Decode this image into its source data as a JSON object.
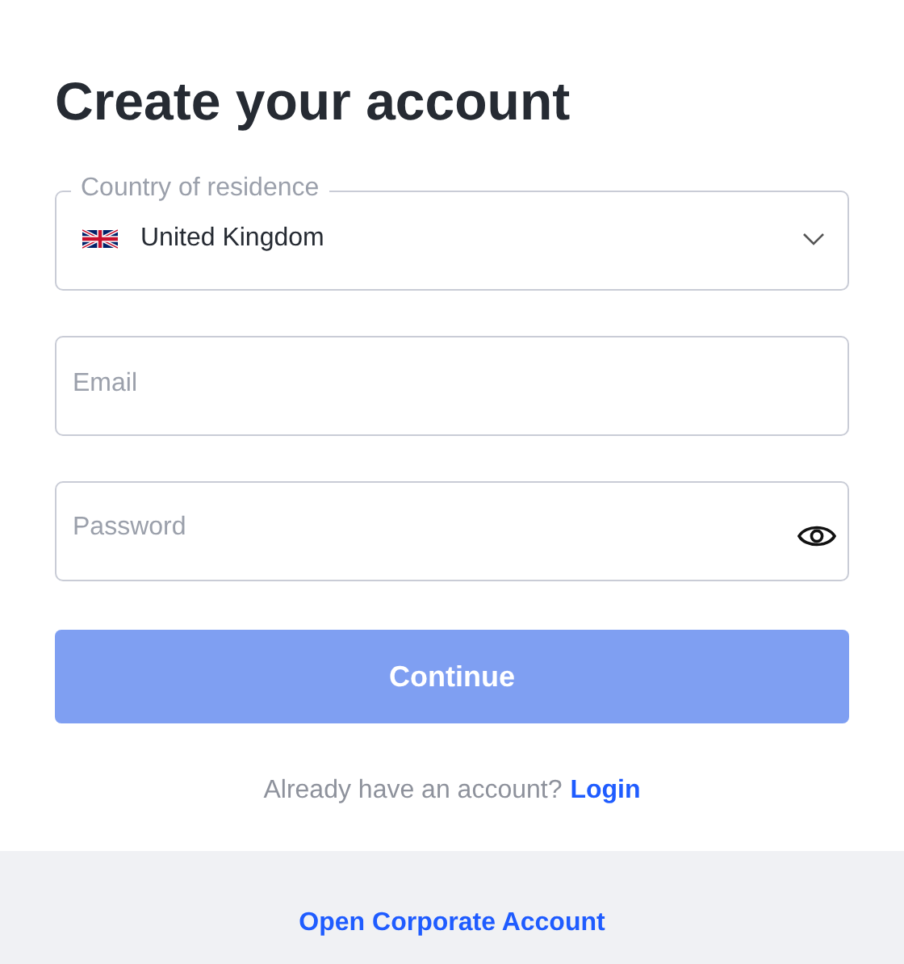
{
  "heading": "Create your account",
  "country_field": {
    "label": "Country of residence",
    "value": "United Kingdom"
  },
  "email_field": {
    "placeholder": "Email"
  },
  "password_field": {
    "placeholder": "Password"
  },
  "continue_button": {
    "label": "Continue",
    "disabled": true
  },
  "login_prompt": {
    "text": "Already have an account?",
    "link": "Login"
  },
  "footer": {
    "link": "Open Corporate Account"
  }
}
